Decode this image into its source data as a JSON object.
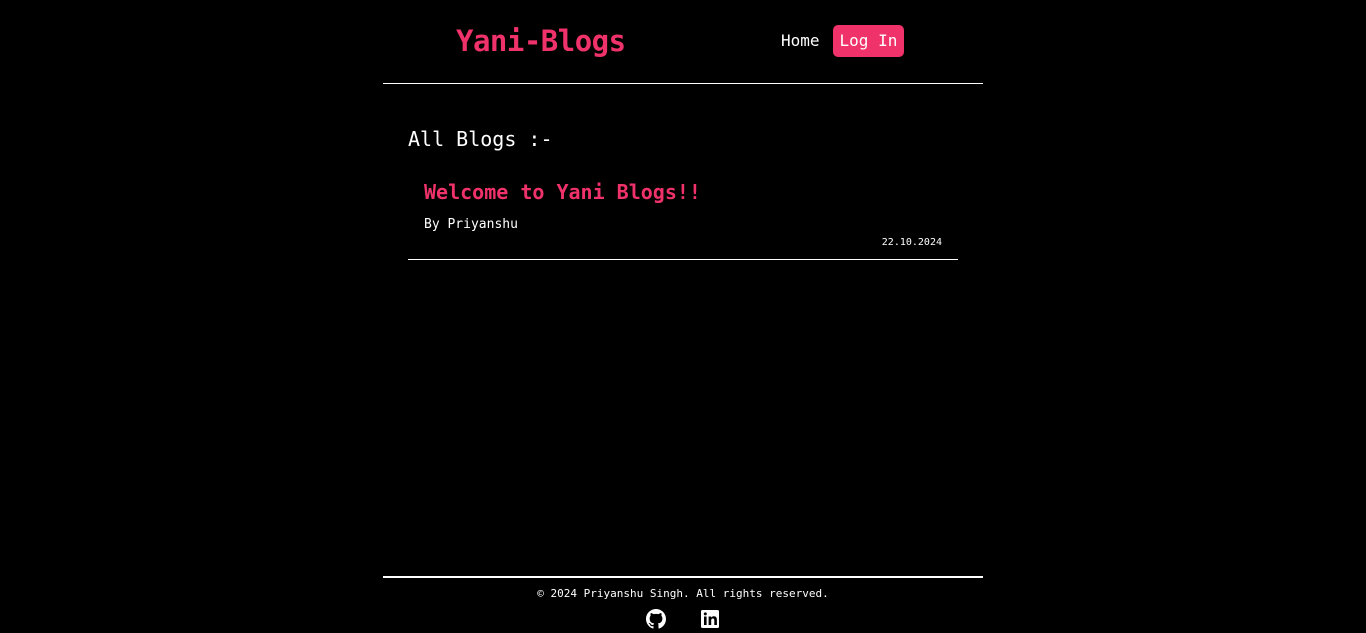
{
  "header": {
    "brand": "Yani-Blogs",
    "nav": {
      "home_label": "Home",
      "login_label": "Log In"
    }
  },
  "main": {
    "section_title": "All Blogs :-",
    "posts": [
      {
        "title": "Welcome to Yani Blogs!!",
        "author": "By Priyanshu",
        "date": "22.10.2024"
      }
    ]
  },
  "footer": {
    "copyright": "© 2024 Priyanshu Singh. All rights reserved.",
    "socials": [
      {
        "icon": "github-icon"
      },
      {
        "icon": "linkedin-icon"
      }
    ]
  },
  "colors": {
    "background": "#000000",
    "accent": "#f0326a",
    "text": "#ffffff"
  }
}
